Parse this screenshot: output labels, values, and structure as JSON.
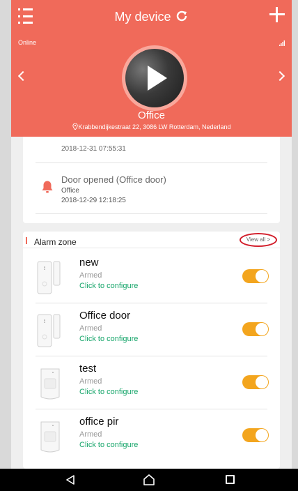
{
  "header": {
    "title": "My device",
    "status": "Online",
    "device_name": "Office",
    "address": "Krabbendijkestraat 22, 3086 LW Rotterdam, Nederland",
    "accent_color": "#f06a5a"
  },
  "events": {
    "partial_time": "2018-12-31 07:55:31",
    "items": [
      {
        "title": "Door opened (Office door)",
        "location": "Office",
        "time": "2018-12-29 12:18:25",
        "icon": "bell-icon"
      }
    ]
  },
  "alarm_zone": {
    "title": "Alarm zone",
    "view_all": "View all >",
    "items": [
      {
        "name": "new",
        "state": "Armed",
        "action": "Click to configure",
        "sensor": "door-sensor-icon",
        "enabled": true
      },
      {
        "name": "Office door",
        "state": "Armed",
        "action": "Click to configure",
        "sensor": "door-sensor-icon",
        "enabled": true
      },
      {
        "name": "test",
        "state": "Armed",
        "action": "Click to configure",
        "sensor": "pir-sensor-icon",
        "enabled": true
      },
      {
        "name": "office pir",
        "state": "Armed",
        "action": "Click to configure",
        "sensor": "pir-sensor-icon",
        "enabled": true
      }
    ],
    "toggle_color": "#f3a51e",
    "config_color": "#16a56a"
  },
  "nav": {
    "icons": [
      "back-icon",
      "home-icon",
      "recent-apps-icon"
    ]
  }
}
